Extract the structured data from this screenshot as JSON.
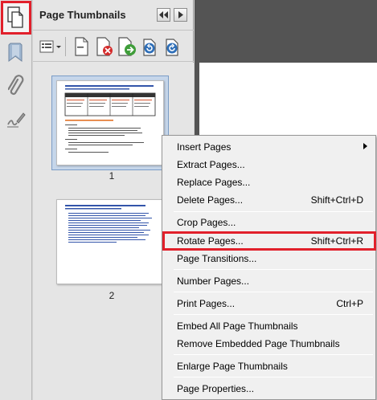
{
  "left_toolbar": {
    "buttons": [
      "page-thumbnails-icon",
      "bookmarks-icon",
      "attachments-icon",
      "signatures-icon"
    ]
  },
  "panel": {
    "title": "Page Thumbnails",
    "thumbnails": [
      {
        "page_label": "1",
        "selected": true
      },
      {
        "page_label": "2",
        "selected": false
      }
    ]
  },
  "context_menu": {
    "items": [
      {
        "label": "Insert Pages",
        "shortcut": "",
        "submenu": true
      },
      {
        "label": "Extract Pages...",
        "shortcut": ""
      },
      {
        "label": "Replace Pages...",
        "shortcut": ""
      },
      {
        "label": "Delete Pages...",
        "shortcut": "Shift+Ctrl+D"
      },
      {
        "label": "Crop Pages...",
        "shortcut": ""
      },
      {
        "label": "Rotate Pages...",
        "shortcut": "Shift+Ctrl+R",
        "highlighted": true
      },
      {
        "label": "Page Transitions...",
        "shortcut": ""
      },
      {
        "label": "Number Pages...",
        "shortcut": ""
      },
      {
        "label": "Print Pages...",
        "shortcut": "Ctrl+P"
      },
      {
        "label": "Embed All Page Thumbnails",
        "shortcut": ""
      },
      {
        "label": "Remove Embedded Page Thumbnails",
        "shortcut": ""
      },
      {
        "label": "Enlarge Page Thumbnails",
        "shortcut": ""
      },
      {
        "label": "Page Properties...",
        "shortcut": ""
      }
    ]
  },
  "colors": {
    "highlight_red": "#e1202b",
    "selection_blue": "#c6d6ea"
  }
}
